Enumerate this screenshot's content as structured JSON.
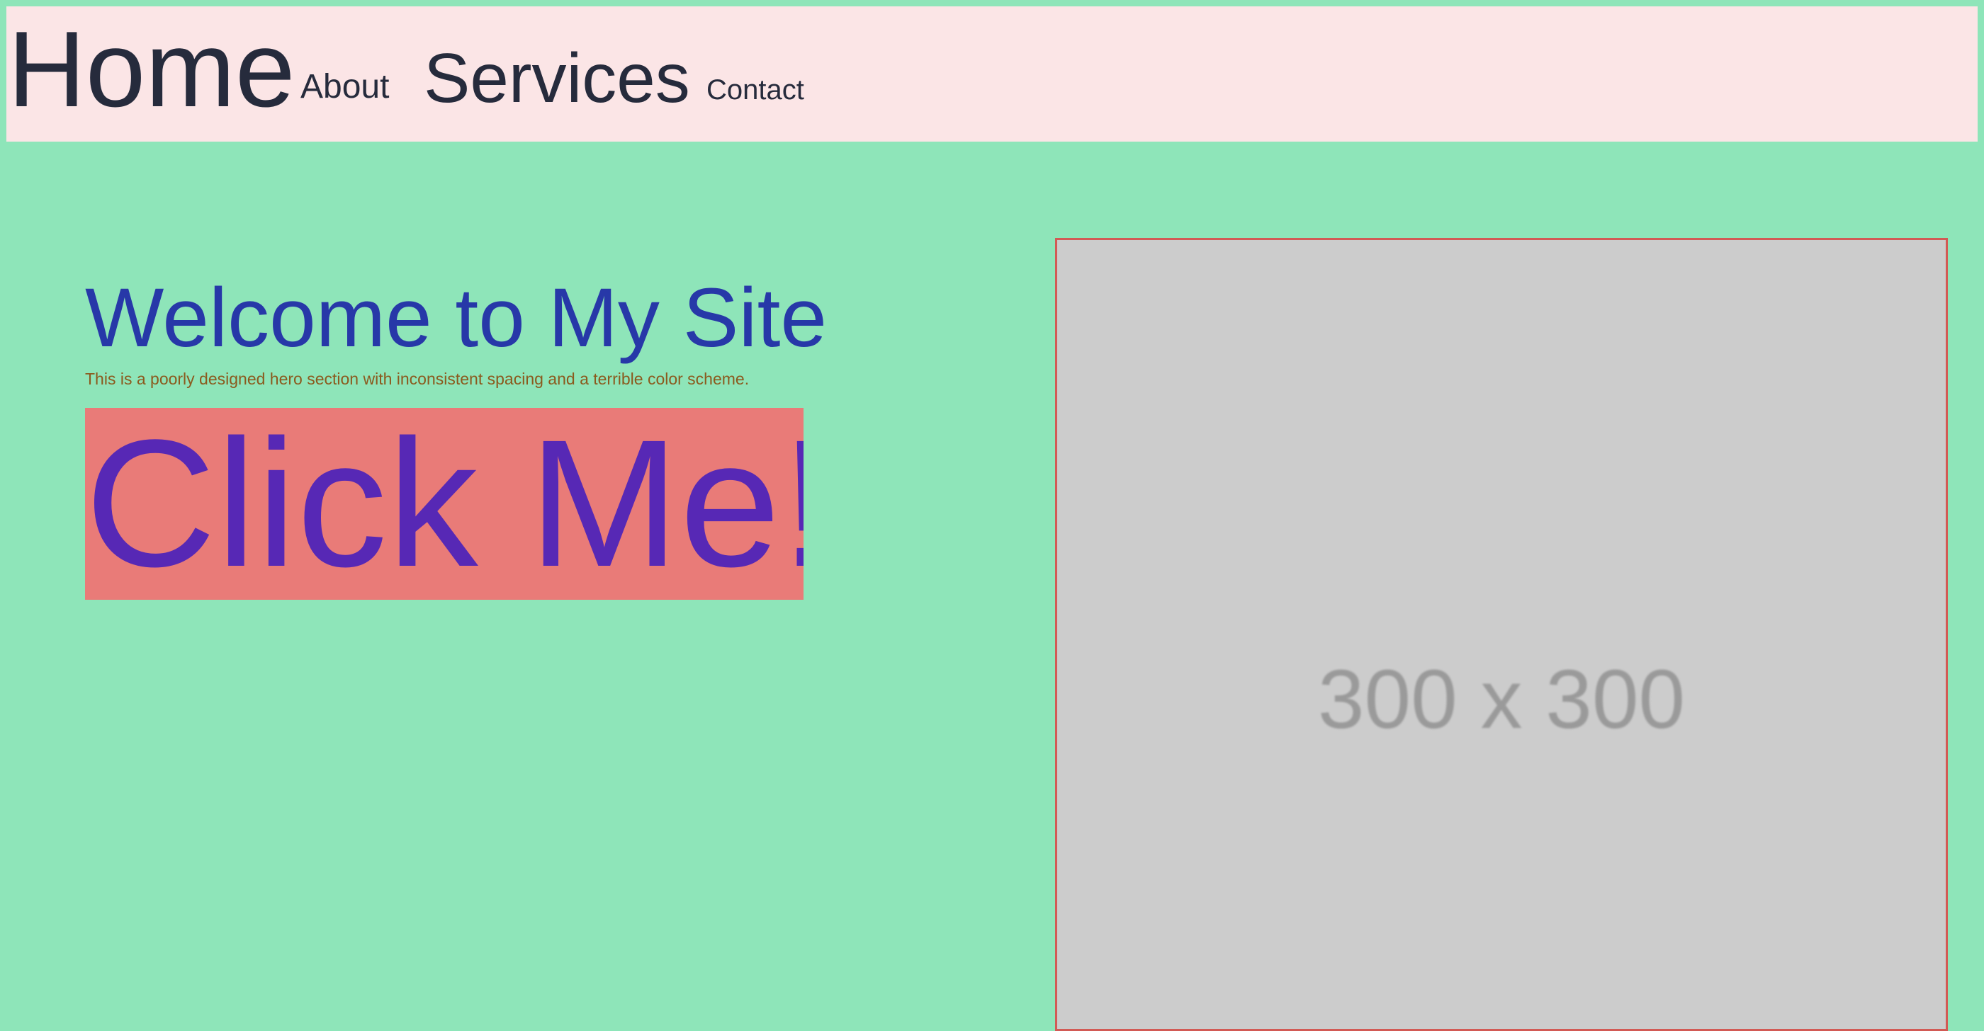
{
  "nav": {
    "items": [
      {
        "label": "Home"
      },
      {
        "label": "About"
      },
      {
        "label": "Services"
      },
      {
        "label": "Contact"
      }
    ]
  },
  "hero": {
    "title": "Welcome to My Site",
    "subtitle": "This is a poorly designed hero section with inconsistent spacing and a terrible color scheme.",
    "cta_label": "Click Me!"
  },
  "image": {
    "placeholder_text": "300 x 300"
  },
  "colors": {
    "page_background": "#8ee5b9",
    "nav_background": "#fbe5e6",
    "nav_text": "#262b3c",
    "title_text": "#2738a8",
    "subtitle_text": "#8b5a1e",
    "button_background": "#e97b78",
    "button_text": "#5728b5",
    "image_background": "#cccccc",
    "image_border": "#d25a55"
  }
}
